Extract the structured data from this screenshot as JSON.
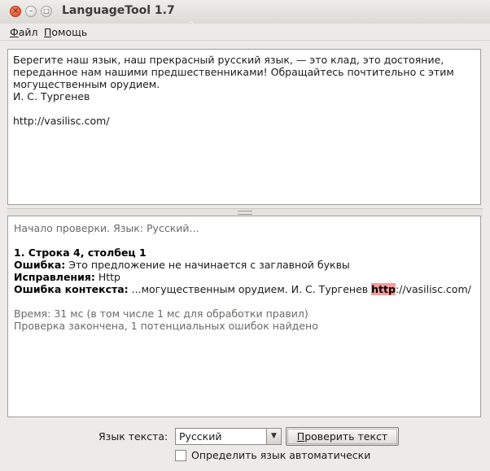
{
  "window": {
    "title": "LanguageTool 1.7",
    "close_glyph": "×",
    "min_glyph": "–",
    "max_glyph": "□"
  },
  "menu": {
    "file_mnemonic": "Ф",
    "file_rest": "айл",
    "help_mnemonic": "П",
    "help_rest": "омощь"
  },
  "editor": {
    "text": "Берегите наш язык, наш прекрасный русский язык, — это клад, это достояние,\nпереданное нам нашими предшественниками! Обращайтесь почтительно с этим\nмогущественным орудием.\nИ. С. Тургенев\n\nhttp://vasilisc.com/"
  },
  "results": {
    "start_line": "Начало проверки. Язык: Русский...",
    "position_heading": "1. Строка 4, столбец 1",
    "error_label": "Ошибка:",
    "error_text": " Это предложение не начинается с заглавной буквы",
    "correction_label": "Исправления:",
    "correction_text": " Http",
    "context_label": "Ошибка контекста:",
    "context_before": " ...могущественным орудием. И. С. Тургенев ",
    "context_error": "http",
    "context_after": "://vasilisc.com/",
    "time_line": "Время: 31 мс (в том числе 1 мс для обработки правил)",
    "summary_line": "Проверка закончена, 1 потенциальных ошибок найдено"
  },
  "controls": {
    "language_label": "Язык текста:",
    "language_selected": "Русский",
    "check_button_mnemonic": "П",
    "check_button_rest": "роверить текст",
    "auto_detect_label": "Определить язык автоматически",
    "auto_detect_checked": false
  },
  "colors": {
    "error_highlight": "#f39f9b",
    "close_button": "#e05a32"
  }
}
